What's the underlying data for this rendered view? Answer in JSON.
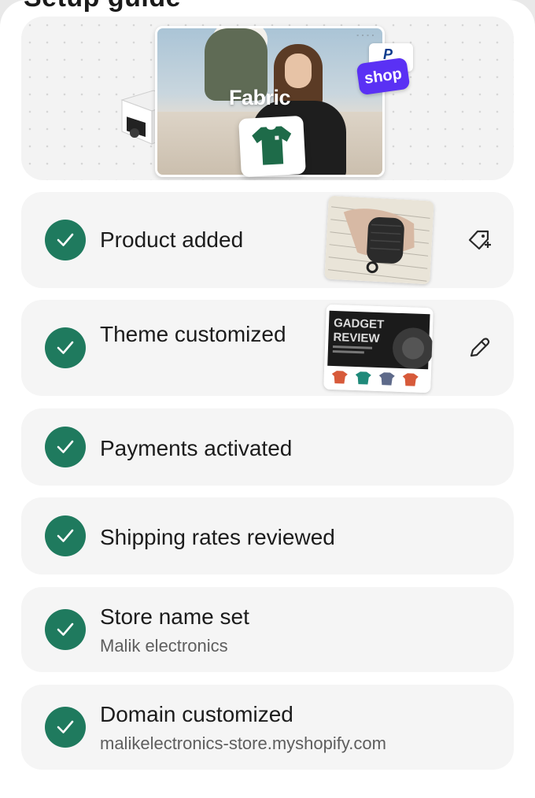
{
  "header": {
    "partial_title": "Setup guide"
  },
  "hero": {
    "brand_label": "Fabric",
    "shop_badge": "shop",
    "paypal_mark": "P",
    "photo_nav": "◦ ◦ ◦ ◦"
  },
  "tasks": [
    {
      "title": "Product added",
      "subtitle": "",
      "status": "complete",
      "icon": "check-icon",
      "action_icon": "tag-add-icon"
    },
    {
      "title": "Theme customized",
      "subtitle": "",
      "status": "complete",
      "icon": "check-icon",
      "action_icon": "pencil-icon"
    },
    {
      "title": "Payments activated",
      "subtitle": "",
      "status": "complete",
      "icon": "check-icon"
    },
    {
      "title": "Shipping rates reviewed",
      "subtitle": "",
      "status": "complete",
      "icon": "check-icon"
    },
    {
      "title": "Store name set",
      "subtitle": "Malik electronics",
      "status": "complete",
      "icon": "check-icon"
    },
    {
      "title": "Domain customized",
      "subtitle": "malikelectronics-store.myshopify.com",
      "status": "complete",
      "icon": "check-icon"
    }
  ],
  "theme_preview": {
    "headline_1": "GADGET",
    "headline_2": "REVIEW"
  },
  "colors": {
    "check_green": "#1f7a5e",
    "card_bg": "#f5f5f5",
    "shop_purple": "#5a31f4"
  }
}
